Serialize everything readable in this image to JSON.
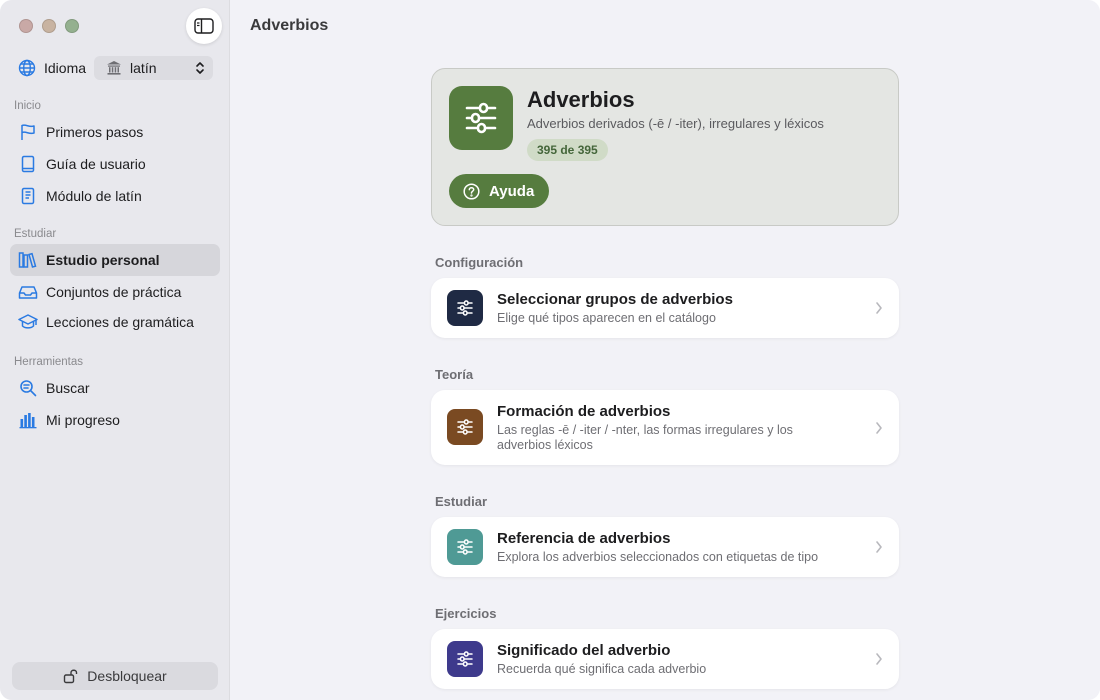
{
  "sidebar": {
    "language_label": "Idioma",
    "language_value": "latín",
    "sections": {
      "inicio": "Inicio",
      "estudiar": "Estudiar",
      "herramientas": "Herramientas"
    },
    "items": {
      "primeros_pasos": "Primeros pasos",
      "guia_usuario": "Guía de usuario",
      "modulo_latin": "Módulo de latín",
      "estudio_personal": "Estudio personal",
      "conjuntos_practica": "Conjuntos de práctica",
      "lecciones_gramatica": "Lecciones de gramática",
      "buscar": "Buscar",
      "mi_progreso": "Mi progreso"
    },
    "unlock_label": "Desbloquear"
  },
  "main": {
    "title": "Adverbios",
    "hero": {
      "title": "Adverbios",
      "subtitle": "Adverbios derivados (-ē / -iter), irregulares y léxicos",
      "badge": "395 de 395",
      "help_label": "Ayuda"
    },
    "groups": {
      "configuracion": "Configuración",
      "teoria": "Teoría",
      "estudiar": "Estudiar",
      "ejercicios": "Ejercicios"
    },
    "cards": {
      "seleccionar": {
        "title": "Seleccionar grupos de adverbios",
        "desc": "Elige qué tipos aparecen en el catálogo"
      },
      "formacion": {
        "title": "Formación de adverbios",
        "desc": "Las reglas -ē / -iter / -nter, las formas irregulares y los adverbios léxicos"
      },
      "referencia": {
        "title": "Referencia de adverbios",
        "desc": "Explora los adverbios seleccionados con etiquetas de tipo"
      },
      "significado": {
        "title": "Significado del adverbio",
        "desc": "Recuerda qué significa cada adverbio"
      }
    }
  },
  "colors": {
    "accent_blue": "#2a7ae2",
    "hero_green": "#567c3f",
    "card_icon_navy": "#1f2a44",
    "card_icon_brown": "#7a4a22",
    "card_icon_teal": "#4f9a95",
    "card_icon_purple": "#3e3a8c"
  },
  "icons": {
    "globe": "globe-icon",
    "flag": "flag-icon",
    "book": "book-icon",
    "module": "book-text-icon",
    "books": "books-icon",
    "tray": "tray-icon",
    "grad_cap": "graduation-cap-icon",
    "search": "search-icon",
    "chart": "bar-chart-icon",
    "lock": "unlock-icon",
    "sliders": "sliders-icon"
  }
}
